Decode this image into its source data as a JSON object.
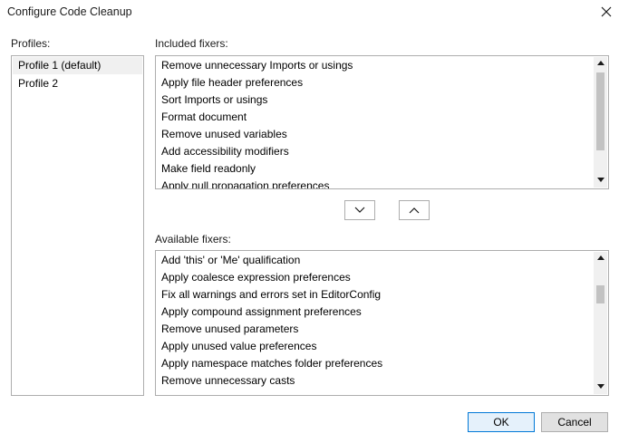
{
  "window": {
    "title": "Configure Code Cleanup"
  },
  "profiles": {
    "label": "Profiles:",
    "items": [
      "Profile 1 (default)",
      "Profile 2"
    ],
    "selected_index": 0
  },
  "included": {
    "label": "Included fixers:",
    "items": [
      "Remove unnecessary Imports or usings",
      "Apply file header preferences",
      "Sort Imports or usings",
      "Format document",
      "Remove unused variables",
      "Add accessibility modifiers",
      "Make field readonly",
      "Apply null propagation preferences"
    ],
    "scroll_position": 0
  },
  "available": {
    "label": "Available fixers:",
    "items": [
      "Add 'this' or 'Me' qualification",
      "Apply coalesce expression preferences",
      "Fix all warnings and errors set in EditorConfig",
      "Apply compound assignment preferences",
      "Remove unused parameters",
      "Apply unused value preferences",
      "Apply namespace matches folder preferences",
      "Remove unnecessary casts"
    ],
    "scroll_position": 0.2
  },
  "buttons": {
    "ok": "OK",
    "cancel": "Cancel"
  },
  "colors": {
    "accent": "#0078d7",
    "border": "#adadad",
    "selection": "#f0f0f0",
    "scroll_arrow": "#1a1a1a",
    "scroll_thumb": "#c2c2c2"
  }
}
